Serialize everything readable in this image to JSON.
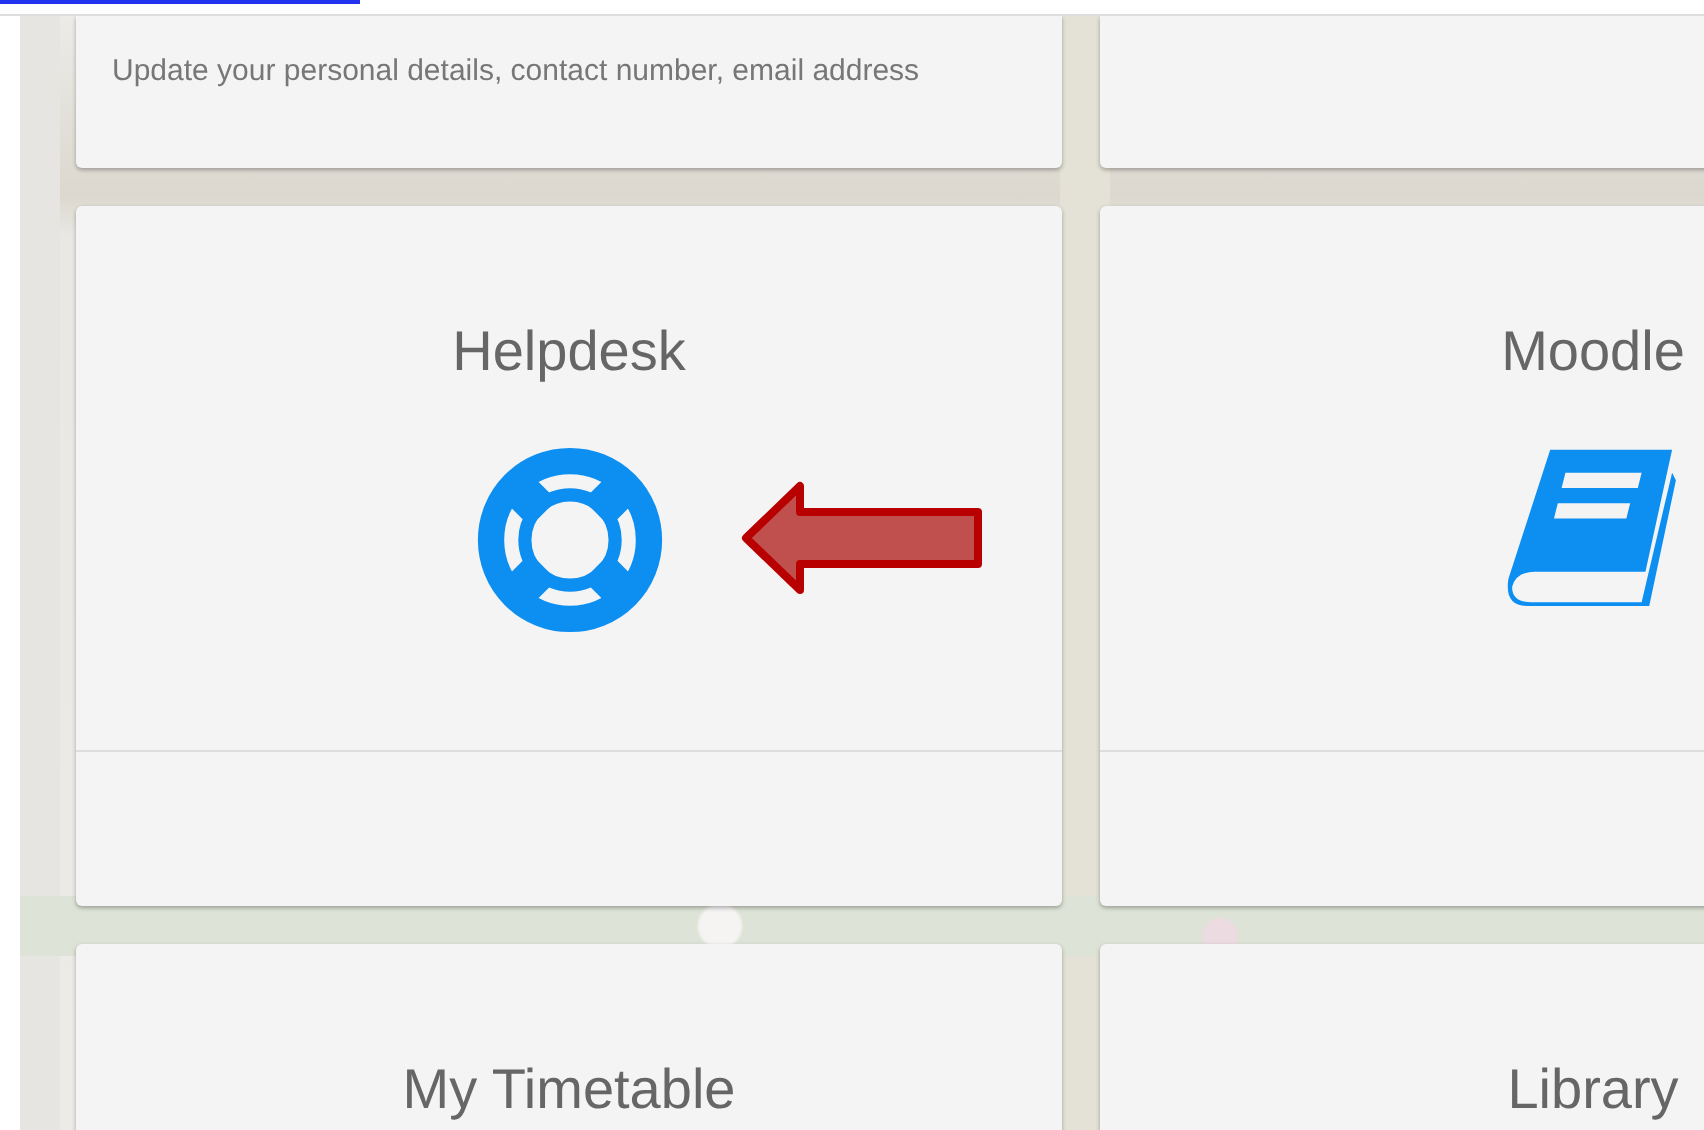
{
  "cards": [
    {
      "kind": "note",
      "description": "Update your personal details, contact number, email address"
    },
    {
      "kind": "blank"
    },
    {
      "kind": "feature",
      "title": "Helpdesk"
    },
    {
      "kind": "feature",
      "title": "Moodle"
    },
    {
      "kind": "heading",
      "title": "My Timetable"
    },
    {
      "kind": "heading",
      "title": "Library"
    }
  ]
}
